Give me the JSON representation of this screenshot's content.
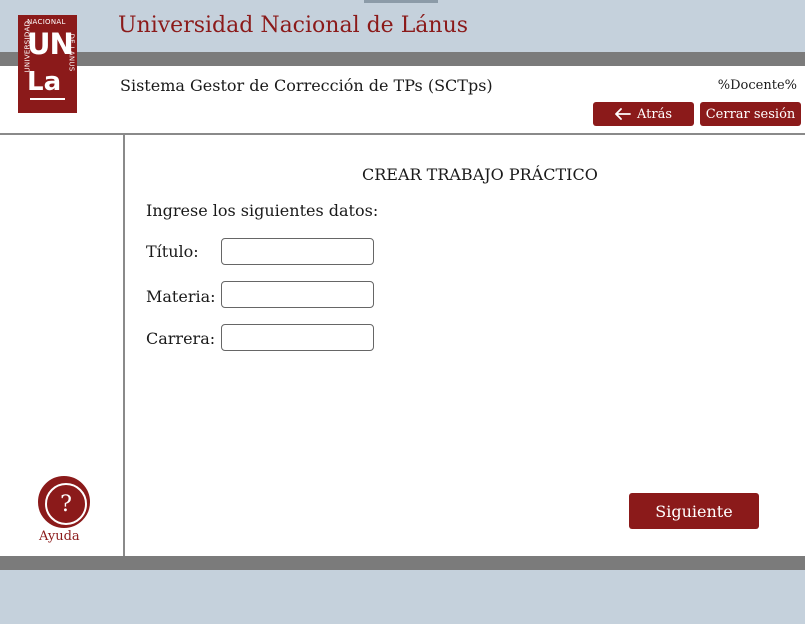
{
  "header": {
    "university_title": "Universidad Nacional de Lánus",
    "system_title": "Sistema Gestor de Corrección de TPs (SCTps)",
    "user_placeholder": "%Docente%",
    "back_button": "Atrás",
    "logout_button": "Cerrar sesión"
  },
  "logo": {
    "top_text": "NACIONAL",
    "left_text": "UNIVERSIDAD",
    "right_text": "DE LANUS",
    "main_line1": "UN",
    "main_line2": "La",
    "icon": "university-logo"
  },
  "main": {
    "title": "CREAR TRABAJO PRÁCTICO",
    "instructions": "Ingrese los siguientes datos:",
    "fields": [
      {
        "label": "Título:",
        "value": "",
        "placeholder": ""
      },
      {
        "label": "Materia:",
        "value": "",
        "placeholder": ""
      },
      {
        "label": "Carrera:",
        "value": "",
        "placeholder": ""
      }
    ],
    "next_button": "Siguiente"
  },
  "help": {
    "icon_glyph": "?",
    "label": "Ayuda",
    "icon": "help-icon"
  },
  "icons": {
    "back": "arrow-left-icon"
  },
  "colors": {
    "brand": "#8b1a1a",
    "band": "#c5d1dc",
    "divider": "#7b7b7b"
  }
}
